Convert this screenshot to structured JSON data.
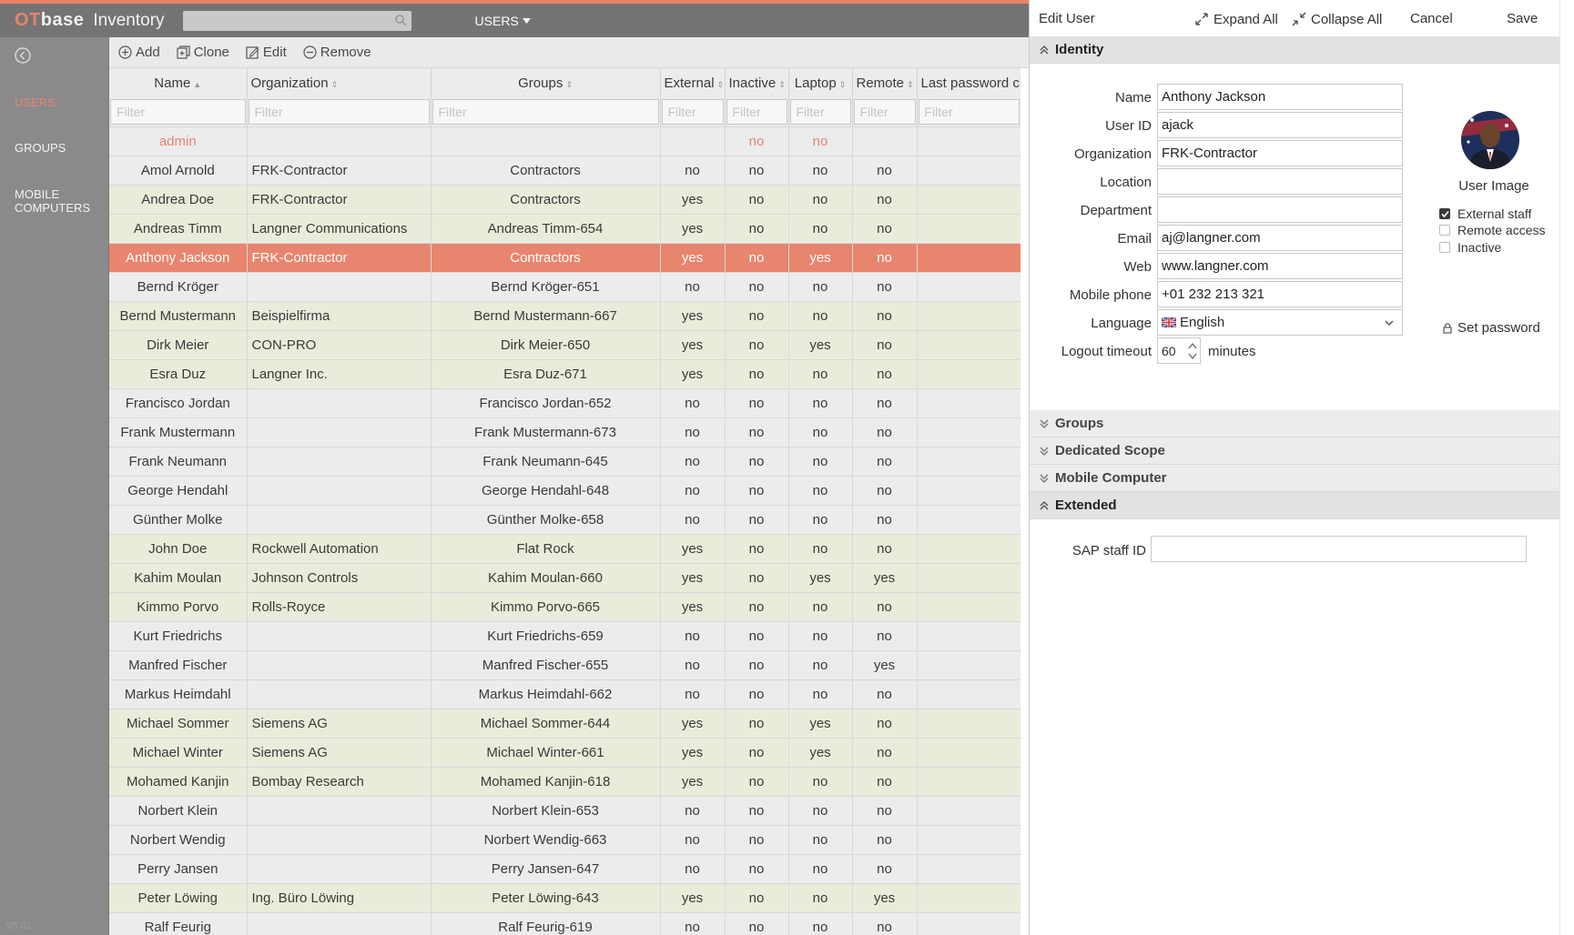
{
  "app": {
    "logo_ot": "OT",
    "logo_base": "base",
    "name": "Inventory",
    "menu": "USERS"
  },
  "nav": {
    "users": "USERS",
    "groups": "GROUPS",
    "mobile": "MOBILE COMPUTERS",
    "version": "V8.01"
  },
  "toolbar": {
    "add": "Add",
    "clone": "Clone",
    "edit": "Edit",
    "remove": "Remove"
  },
  "table": {
    "columns": [
      "Name",
      "Organization",
      "Groups",
      "External",
      "Inactive",
      "Laptop",
      "Remote",
      "Last password cha"
    ],
    "filter_placeholder": "Filter",
    "rows": [
      {
        "name": "admin",
        "org": "",
        "groups": "",
        "external": "",
        "inactive": "no",
        "laptop": "no",
        "remote": ""
      },
      {
        "name": "Amol Arnold",
        "org": "FRK-Contractor",
        "groups": "Contractors",
        "external": "no",
        "inactive": "no",
        "laptop": "no",
        "remote": "no"
      },
      {
        "name": "Andrea Doe",
        "org": "FRK-Contractor",
        "groups": "Contractors",
        "external": "yes",
        "inactive": "no",
        "laptop": "no",
        "remote": "no"
      },
      {
        "name": "Andreas Timm",
        "org": "Langner Communications",
        "groups": "Andreas Timm-654",
        "external": "yes",
        "inactive": "no",
        "laptop": "no",
        "remote": "no"
      },
      {
        "name": "Anthony Jackson",
        "org": "FRK-Contractor",
        "groups": "Contractors",
        "external": "yes",
        "inactive": "no",
        "laptop": "yes",
        "remote": "no"
      },
      {
        "name": "Bernd Kröger",
        "org": "",
        "groups": "Bernd Kröger-651",
        "external": "no",
        "inactive": "no",
        "laptop": "no",
        "remote": "no"
      },
      {
        "name": "Bernd Mustermann",
        "org": "Beispielfirma",
        "groups": "Bernd Mustermann-667",
        "external": "yes",
        "inactive": "no",
        "laptop": "no",
        "remote": "no"
      },
      {
        "name": "Dirk Meier",
        "org": "CON-PRO",
        "groups": "Dirk Meier-650",
        "external": "yes",
        "inactive": "no",
        "laptop": "yes",
        "remote": "no"
      },
      {
        "name": "Esra Duz",
        "org": "Langner Inc.",
        "groups": "Esra Duz-671",
        "external": "yes",
        "inactive": "no",
        "laptop": "no",
        "remote": "no"
      },
      {
        "name": "Francisco Jordan",
        "org": "",
        "groups": "Francisco Jordan-652",
        "external": "no",
        "inactive": "no",
        "laptop": "no",
        "remote": "no"
      },
      {
        "name": "Frank Mustermann",
        "org": "",
        "groups": "Frank Mustermann-673",
        "external": "no",
        "inactive": "no",
        "laptop": "no",
        "remote": "no"
      },
      {
        "name": "Frank Neumann",
        "org": "",
        "groups": "Frank Neumann-645",
        "external": "no",
        "inactive": "no",
        "laptop": "no",
        "remote": "no"
      },
      {
        "name": "George Hendahl",
        "org": "",
        "groups": "George Hendahl-648",
        "external": "no",
        "inactive": "no",
        "laptop": "no",
        "remote": "no"
      },
      {
        "name": "Günther Molke",
        "org": "",
        "groups": "Günther Molke-658",
        "external": "no",
        "inactive": "no",
        "laptop": "no",
        "remote": "no"
      },
      {
        "name": "John Doe",
        "org": "Rockwell Automation",
        "groups": "Flat Rock",
        "external": "yes",
        "inactive": "no",
        "laptop": "no",
        "remote": "no"
      },
      {
        "name": "Kahim Moulan",
        "org": "Johnson Controls",
        "groups": "Kahim Moulan-660",
        "external": "yes",
        "inactive": "no",
        "laptop": "yes",
        "remote": "yes"
      },
      {
        "name": "Kimmo Porvo",
        "org": "Rolls-Royce",
        "groups": "Kimmo Porvo-665",
        "external": "yes",
        "inactive": "no",
        "laptop": "no",
        "remote": "no"
      },
      {
        "name": "Kurt Friedrichs",
        "org": "",
        "groups": "Kurt Friedrichs-659",
        "external": "no",
        "inactive": "no",
        "laptop": "no",
        "remote": "no"
      },
      {
        "name": "Manfred Fischer",
        "org": "",
        "groups": "Manfred Fischer-655",
        "external": "no",
        "inactive": "no",
        "laptop": "no",
        "remote": "yes"
      },
      {
        "name": "Markus Heimdahl",
        "org": "",
        "groups": "Markus Heimdahl-662",
        "external": "no",
        "inactive": "no",
        "laptop": "no",
        "remote": "no"
      },
      {
        "name": "Michael Sommer",
        "org": "Siemens AG",
        "groups": "Michael Sommer-644",
        "external": "yes",
        "inactive": "no",
        "laptop": "yes",
        "remote": "no"
      },
      {
        "name": "Michael Winter",
        "org": "Siemens AG",
        "groups": "Michael Winter-661",
        "external": "yes",
        "inactive": "no",
        "laptop": "yes",
        "remote": "no"
      },
      {
        "name": "Mohamed Kanjin",
        "org": "Bombay Research",
        "groups": "Mohamed Kanjin-618",
        "external": "yes",
        "inactive": "no",
        "laptop": "no",
        "remote": "no"
      },
      {
        "name": "Norbert Klein",
        "org": "",
        "groups": "Norbert Klein-653",
        "external": "no",
        "inactive": "no",
        "laptop": "no",
        "remote": "no"
      },
      {
        "name": "Norbert Wendig",
        "org": "",
        "groups": "Norbert Wendig-663",
        "external": "no",
        "inactive": "no",
        "laptop": "no",
        "remote": "no"
      },
      {
        "name": "Perry Jansen",
        "org": "",
        "groups": "Perry Jansen-647",
        "external": "no",
        "inactive": "no",
        "laptop": "no",
        "remote": "no"
      },
      {
        "name": "Peter Löwing",
        "org": "Ing. Büro Löwing",
        "groups": "Peter Löwing-643",
        "external": "yes",
        "inactive": "no",
        "laptop": "no",
        "remote": "yes"
      },
      {
        "name": "Ralf Feurig",
        "org": "",
        "groups": "Ralf Feurig-619",
        "external": "no",
        "inactive": "no",
        "laptop": "no",
        "remote": "no"
      }
    ]
  },
  "panel": {
    "title": "Edit User",
    "expand_all": "Expand All",
    "collapse_all": "Collapse All",
    "cancel": "Cancel",
    "save": "Save",
    "sections": {
      "identity": "Identity",
      "groups": "Groups",
      "scope": "Dedicated Scope",
      "mobile": "Mobile Computer",
      "extended": "Extended"
    },
    "identity": {
      "labels": {
        "name": "Name",
        "userid": "User ID",
        "org": "Organization",
        "location": "Location",
        "department": "Department",
        "email": "Email",
        "web": "Web",
        "mobile": "Mobile phone",
        "language": "Language",
        "timeout": "Logout timeout"
      },
      "values": {
        "name": "Anthony Jackson",
        "userid": "ajack",
        "org": "FRK-Contractor",
        "location": "",
        "department": "",
        "email": "aj@langner.com",
        "web": "www.langner.com",
        "mobile": "+01 232 213 321",
        "language": "English",
        "timeout": "60",
        "minutes": "minutes"
      },
      "user_image": "User Image",
      "checkboxes": {
        "external": "External staff",
        "remote": "Remote access",
        "inactive": "Inactive"
      },
      "set_password": "Set password"
    },
    "extended": {
      "sap_label": "SAP staff ID",
      "sap_value": ""
    }
  },
  "colors": {
    "accent": "#e8836b",
    "selected_row": "#e8856e",
    "external_row": "#ebebdb"
  }
}
